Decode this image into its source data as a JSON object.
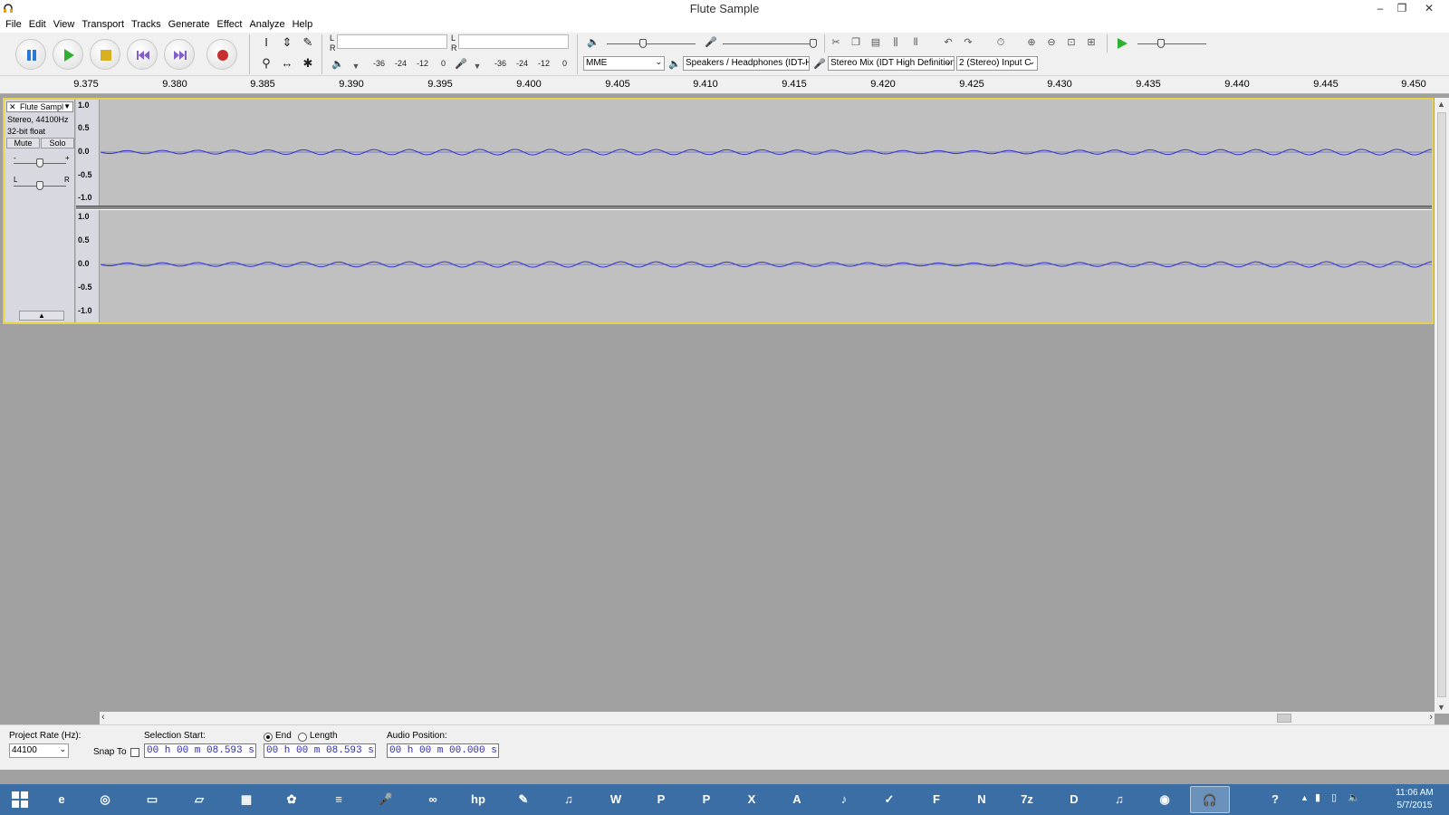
{
  "window": {
    "title": "Flute Sample",
    "minimize": "–",
    "restore": "❐",
    "close": "✕"
  },
  "menu": [
    "File",
    "Edit",
    "View",
    "Transport",
    "Tracks",
    "Generate",
    "Effect",
    "Analyze",
    "Help"
  ],
  "transport": {
    "pause": "pause-icon",
    "play": "play-icon",
    "stop": "stop-icon",
    "skip_start": "skip-to-start-icon",
    "skip_end": "skip-to-end-icon",
    "record": "record-icon"
  },
  "tools": {
    "selection": "I",
    "envelope": "⇕",
    "draw": "✎",
    "zoom": "⚲",
    "timeshift": "↔",
    "multi": "✱"
  },
  "meters": {
    "play_lr": [
      "L",
      "R"
    ],
    "rec_lr": [
      "L",
      "R"
    ],
    "play_scale": [
      "-36",
      "-24",
      "-12",
      "0"
    ],
    "rec_scale": [
      "-36",
      "-24",
      "-12",
      "0"
    ]
  },
  "devices": {
    "host": "MME",
    "output": "Speakers / Headphones (IDT H",
    "input": "Stereo Mix (IDT High Definition",
    "channels": "2 (Stereo) Input C"
  },
  "ruler": [
    "9.375",
    "9.380",
    "9.385",
    "9.390",
    "9.395",
    "9.400",
    "9.405",
    "9.410",
    "9.415",
    "9.420",
    "9.425",
    "9.430",
    "9.435",
    "9.440",
    "9.445",
    "9.450"
  ],
  "track": {
    "name": "Flute Sampl",
    "close": "✕",
    "format": "Stereo, 44100Hz",
    "bitdepth": "32-bit float",
    "mute": "Mute",
    "solo": "Solo",
    "gain_minus": "-",
    "gain_plus": "+",
    "pan_l": "L",
    "pan_r": "R",
    "scale": [
      "1.0",
      "0.5",
      "0.0",
      "-0.5",
      "-1.0"
    ]
  },
  "selection": {
    "rate_label": "Project Rate (Hz):",
    "rate_value": "44100",
    "snap_label": "Snap To",
    "start_label": "Selection Start:",
    "start_value": "00 h 00 m 08.593 s",
    "end_label": "End",
    "length_label": "Length",
    "end_value": "00 h 00 m 08.593 s",
    "audio_pos_label": "Audio Position:",
    "audio_pos_value": "00 h 00 m 00.000 s"
  },
  "taskbar": {
    "items": [
      "W",
      "P",
      "P",
      "X",
      "A",
      "♪",
      "✓",
      "F",
      "N",
      "7z",
      "D",
      "♫",
      "◉",
      "🎧"
    ],
    "clock_time": "11:06 AM",
    "clock_date": "5/7/2015",
    "help": "?"
  },
  "colors": {
    "track_border": "#e6d24a",
    "waveform": "#3232c8",
    "waveform_bg": "#c0c0c0",
    "taskbar": "#3a6ea5",
    "timebox_text": "#2a2ab0"
  }
}
